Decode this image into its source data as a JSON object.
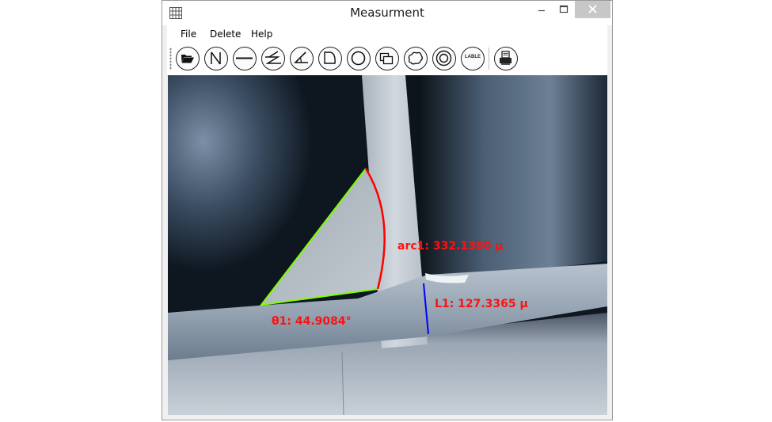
{
  "window": {
    "title": "Measurment",
    "app_icon": "grid-app-icon",
    "controls": {
      "minimize": "minimize-icon",
      "maximize": "maximize-icon",
      "close": "close-icon"
    }
  },
  "menu": {
    "items": [
      {
        "label": "File"
      },
      {
        "label": "Delete"
      },
      {
        "label": "Help"
      }
    ]
  },
  "toolbar": {
    "tools": [
      {
        "icon": "open-folder-icon"
      },
      {
        "icon": "diagonal-line-icon"
      },
      {
        "icon": "horizontal-line-icon"
      },
      {
        "icon": "zigzag-line-icon"
      },
      {
        "icon": "angle-icon"
      },
      {
        "icon": "sector-icon"
      },
      {
        "icon": "circle-icon"
      },
      {
        "icon": "rectangle-overlap-icon"
      },
      {
        "icon": "freeform-area-icon"
      },
      {
        "icon": "concentric-circles-icon"
      },
      {
        "icon": "label-icon",
        "text": "LABLE"
      },
      {
        "icon": "print-icon"
      }
    ]
  },
  "canvas": {
    "measurements": [
      {
        "label": "arc1: 332.1380 µ",
        "color": "#ff0000"
      },
      {
        "label": "L1: 127.3365 µ",
        "color": "#ff0000"
      },
      {
        "label": "θ1: 44.9084°",
        "color": "#ff0000"
      }
    ],
    "overlay_colors": {
      "angle": "#7fff00",
      "arc": "#ff0000",
      "line": "#0000ff"
    }
  }
}
